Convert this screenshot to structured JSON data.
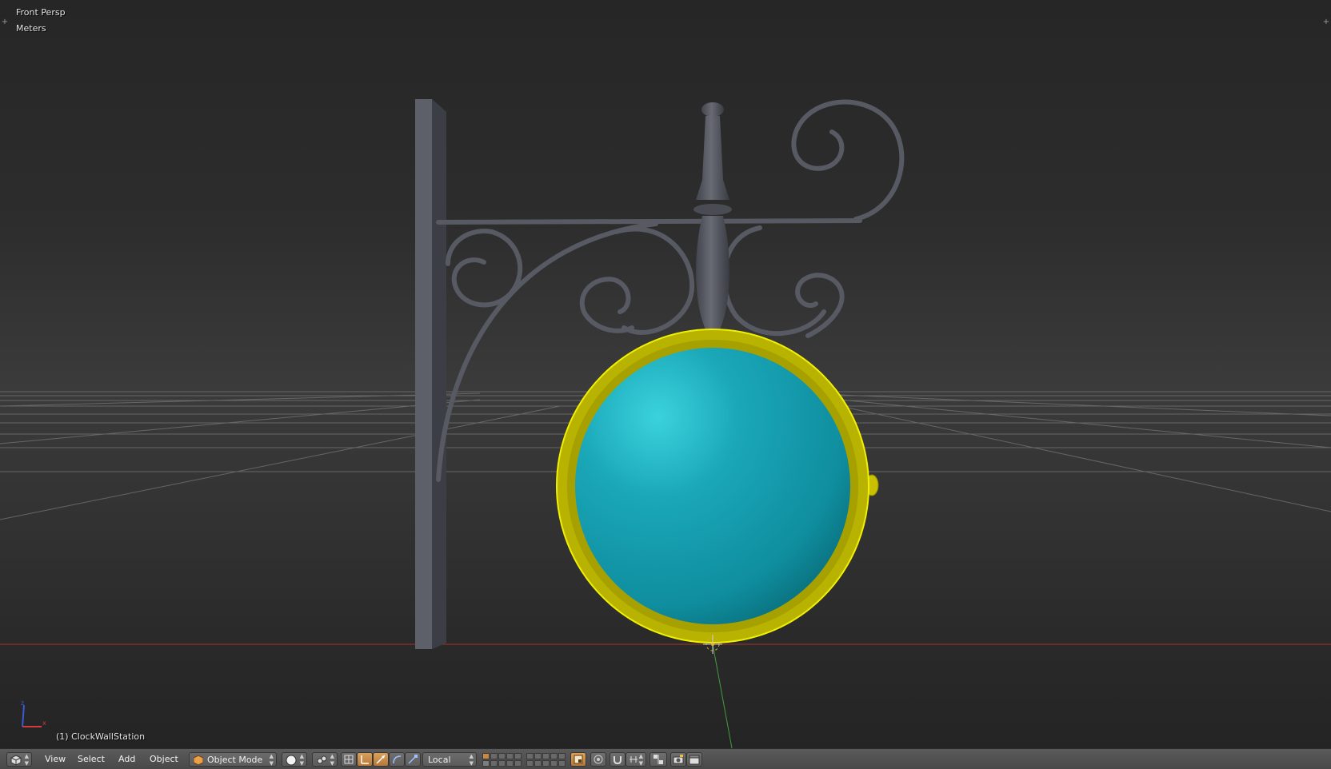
{
  "viewport": {
    "view_name": "Front Persp",
    "units": "Meters",
    "active_object": "(1) ClockWallStation"
  },
  "colors": {
    "clock_face": "#14a0b2",
    "clock_rim": "#b8b200",
    "bracket": "#51535c",
    "grid_line": "#6e6e6e",
    "x_axis": "#a52a2a",
    "y_axis": "#3a9a3a",
    "selection_outline": "#f0f000"
  },
  "header": {
    "editor_type_icon": "cube-icon",
    "menus": [
      "View",
      "Select",
      "Add",
      "Object"
    ],
    "mode_label": "Object Mode",
    "mode_icon": "cube-icon",
    "shading_icon": "solid-sphere-icon",
    "pivot_icon": "pivot-icon",
    "manipulator_icons": [
      "manipulator-icon",
      "translate-icon",
      "rotate-icon",
      "scale-icon"
    ],
    "orientation_label": "Local",
    "layer_icons": [
      "lock-layer-icon"
    ],
    "snap_icons": [
      "snap-magnet-icon",
      "snap-target-icon"
    ],
    "proportional_icons": [
      "proportional-icon",
      "mirror-icon"
    ],
    "render_icons": [
      "render-camera-icon",
      "render-clapboard-icon"
    ]
  }
}
